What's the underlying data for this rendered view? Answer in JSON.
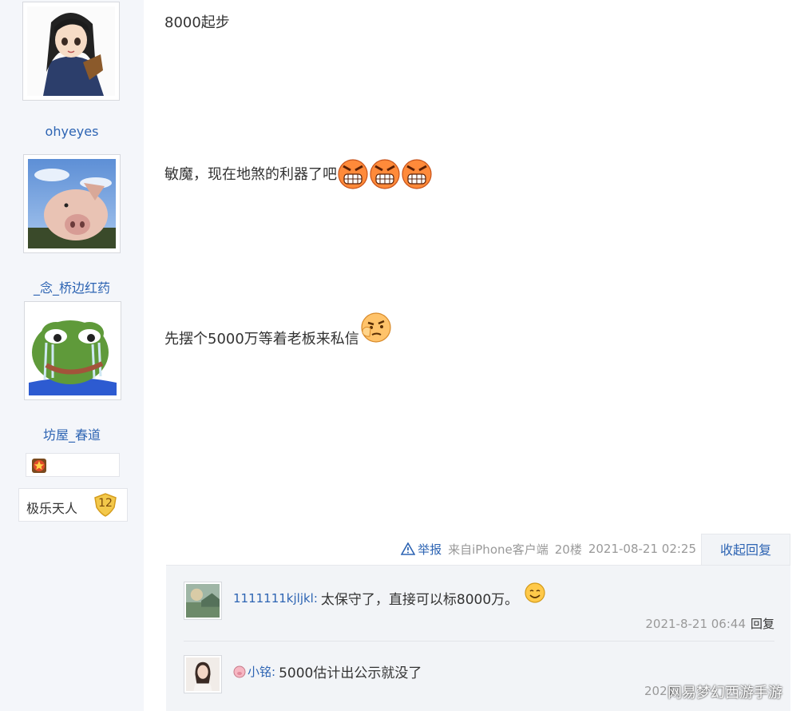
{
  "sidebar": {
    "users": [
      {
        "name": "ohyeyes",
        "avatar_icon": "anime-girl-avatar"
      },
      {
        "name": "_念_桥边红药",
        "avatar_icon": "pig-avatar"
      },
      {
        "name": "坊屋_春道",
        "avatar_icon": "crying-frog-avatar"
      }
    ],
    "level_badge": {
      "title": "极乐天人",
      "level": "12"
    }
  },
  "posts": [
    {
      "text": "8000起步"
    },
    {
      "text": "敏魔，现在地煞的利器了吧",
      "emoji": "angry-face-icon"
    },
    {
      "text": "先摆个5000万等着老板来私信",
      "emoji": "thinking-face-icon"
    }
  ],
  "post_tail": {
    "report": "举报",
    "source": "来自iPhone客户端",
    "floor": "20楼",
    "time": "2021-08-21 02:25",
    "collapse": "收起回复"
  },
  "replies": [
    {
      "user": "1111111kjljkl:",
      "text": "太保守了，直接可以标8000万。",
      "time": "2021-8-21 06:44",
      "reply_btn": "回复"
    },
    {
      "user": "小铭:",
      "text": "5000估计出公示就没了",
      "time": "2021",
      "reply_btn": ""
    }
  ],
  "watermark": "网易梦幻西游手游",
  "colors": {
    "link": "#2d64b3",
    "sidebar_bg": "#f4f6fa",
    "reply_bg": "#f2f4f7"
  }
}
